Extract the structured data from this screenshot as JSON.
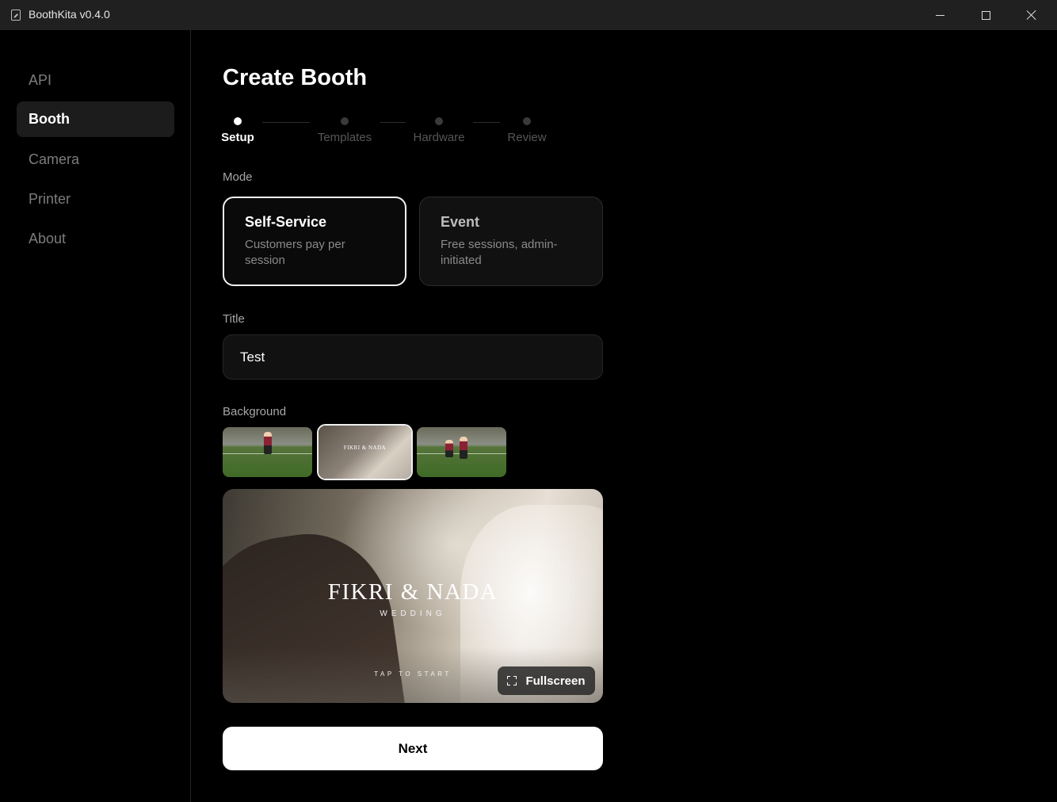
{
  "window": {
    "title": "BoothKita v0.4.0"
  },
  "sidebar": {
    "items": [
      {
        "label": "API"
      },
      {
        "label": "Booth",
        "active": true
      },
      {
        "label": "Camera"
      },
      {
        "label": "Printer"
      },
      {
        "label": "About"
      }
    ]
  },
  "main": {
    "page_title": "Create Booth",
    "steps": [
      {
        "label": "Setup",
        "active": true
      },
      {
        "label": "Templates"
      },
      {
        "label": "Hardware"
      },
      {
        "label": "Review"
      }
    ],
    "mode": {
      "label": "Mode",
      "options": [
        {
          "title": "Self-Service",
          "description": "Customers pay per session",
          "selected": true
        },
        {
          "title": "Event",
          "description": "Free sessions, admin-initiated",
          "selected": false
        }
      ]
    },
    "title_field": {
      "label": "Title",
      "value": "Test"
    },
    "background": {
      "label": "Background",
      "selected_index": 1,
      "thumb_wedding_text": "FIKRI & NADA"
    },
    "preview": {
      "couple_name": "FIKRI & NADA",
      "subtitle": "WEDDING",
      "tap_text": "TAP TO START",
      "fullscreen_label": "Fullscreen"
    },
    "next_label": "Next"
  },
  "colors": {
    "background": "#000000",
    "titlebar": "#202020",
    "nav_active_bg": "#1c1c1c",
    "card_bg": "#111111",
    "primary_button": "#ffffff"
  },
  "icons": {
    "app": "app-icon",
    "minimize": "minimize-icon",
    "maximize": "maximize-icon",
    "close": "close-icon",
    "fullscreen": "fullscreen-icon"
  }
}
